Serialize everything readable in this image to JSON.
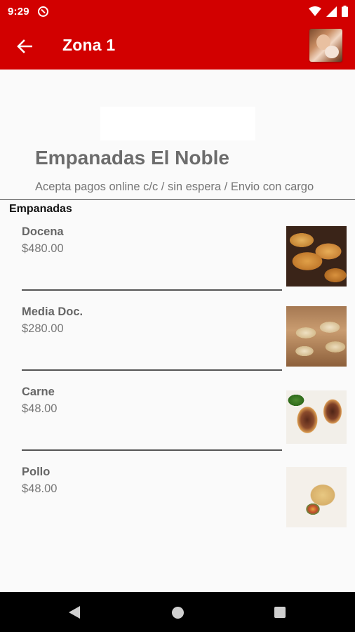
{
  "status_bar": {
    "time": "9:29",
    "icons": [
      "do-not-disturb-icon",
      "wifi-icon",
      "signal-icon",
      "battery-icon"
    ]
  },
  "app_bar": {
    "title": "Zona 1",
    "back_icon": "arrow-left-icon",
    "color": "#d20000"
  },
  "store": {
    "name": "Empanadas El Noble",
    "description": "Acepta pagos online c/c / sin espera / Envio con cargo"
  },
  "category": {
    "title": "Empanadas",
    "items": [
      {
        "name": "Docena",
        "price": "$480.00"
      },
      {
        "name": "Media Doc.",
        "price": "$280.00"
      },
      {
        "name": "Carne",
        "price": "$48.00"
      },
      {
        "name": "Pollo",
        "price": "$48.00"
      }
    ]
  },
  "nav_bar": {
    "icons": [
      "back-triangle-icon",
      "home-circle-icon",
      "recents-square-icon"
    ]
  }
}
